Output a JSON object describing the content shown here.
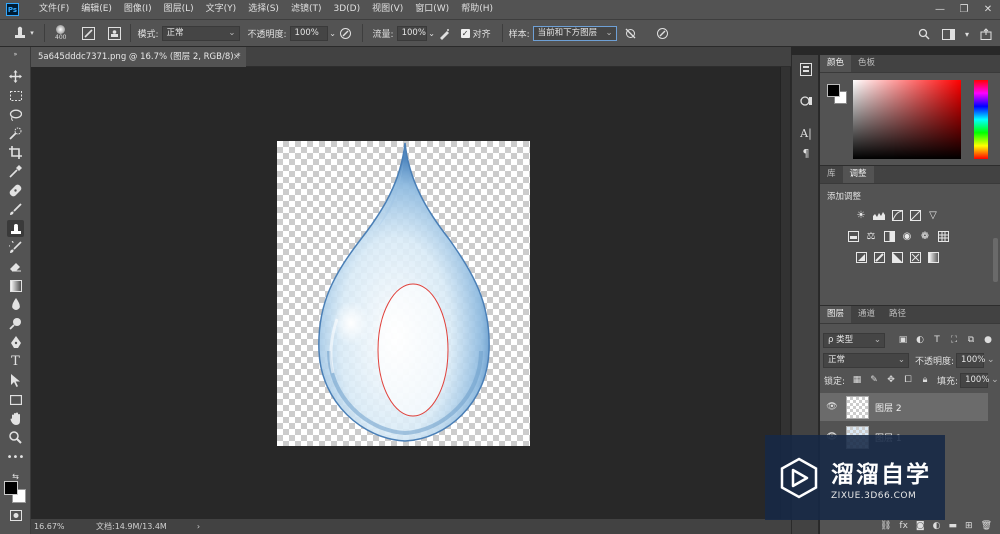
{
  "menubar": {
    "logo": "Ps",
    "items": [
      "文件(F)",
      "编辑(E)",
      "图像(I)",
      "图层(L)",
      "文字(Y)",
      "选择(S)",
      "滤镜(T)",
      "3D(D)",
      "视图(V)",
      "窗口(W)",
      "帮助(H)"
    ],
    "window_controls": [
      "—",
      "❐",
      "✕"
    ]
  },
  "options_bar": {
    "brush_size": "400",
    "mode_label": "模式:",
    "mode_value": "正常",
    "opacity_label": "不透明度:",
    "opacity_value": "100%",
    "flow_label": "流量:",
    "flow_value": "100%",
    "aligned_label": "对齐",
    "aligned_checked": true,
    "sample_label": "样本:",
    "sample_value": "当前和下方图层"
  },
  "document": {
    "tab_title": "5a645dddc7371.png @ 16.7% (图层 2, RGB/8) *",
    "close": "×"
  },
  "status_bar": {
    "zoom": "16.67%",
    "doc_size": "文档:14.9M/13.4M",
    "arrow": "›"
  },
  "color_panel": {
    "tabs": [
      "颜色",
      "色板"
    ],
    "active_tab": 0,
    "foreground": "#000000",
    "background": "#ffffff"
  },
  "adjustments_panel": {
    "tabs": [
      "库",
      "调整"
    ],
    "active_tab": 1,
    "title": "添加调整"
  },
  "layers_panel": {
    "tabs": [
      "图层",
      "通道",
      "路径"
    ],
    "active_tab": 0,
    "filter_kind": "ρ 类型",
    "blend_mode": "正常",
    "opacity_label": "不透明度:",
    "opacity_value": "100%",
    "lock_label": "锁定:",
    "fill_label": "填充:",
    "fill_value": "100%",
    "layers": [
      {
        "name": "图层 2",
        "visible": true,
        "selected": true
      },
      {
        "name": "图层 1",
        "visible": true,
        "selected": false
      }
    ]
  },
  "watermark": {
    "brand": "溜溜自学",
    "url": "ZIXUE.3D66.COM"
  },
  "colors": {
    "ui_dark": "#282828",
    "ui_panel": "#535353",
    "drop_blue": "#5a8fc4",
    "selection_red": "#e0403a",
    "watermark_bg": "#162846"
  }
}
